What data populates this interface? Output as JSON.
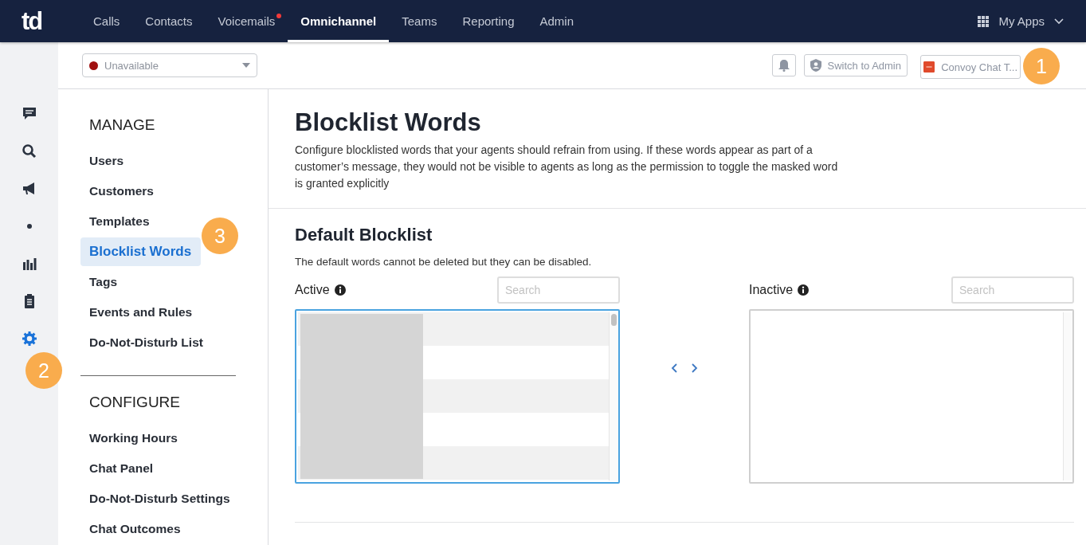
{
  "nav": {
    "logo": "td",
    "tabs": [
      {
        "label": "Calls",
        "selected": false,
        "notification": false
      },
      {
        "label": "Contacts",
        "selected": false,
        "notification": false
      },
      {
        "label": "Voicemails",
        "selected": false,
        "notification": true
      },
      {
        "label": "Omnichannel",
        "selected": true,
        "notification": false
      },
      {
        "label": "Teams",
        "selected": false,
        "notification": false
      },
      {
        "label": "Reporting",
        "selected": false,
        "notification": false
      },
      {
        "label": "Admin",
        "selected": false,
        "notification": false
      }
    ],
    "apps": "My Apps"
  },
  "rail": [
    {
      "kind": "chat",
      "selected": false
    },
    {
      "kind": "search",
      "selected": false
    },
    {
      "kind": "megaphone",
      "selected": false
    },
    {
      "kind": "dot",
      "selected": false
    },
    {
      "kind": "chart",
      "selected": false
    },
    {
      "kind": "clipboard",
      "selected": false
    },
    {
      "kind": "gear",
      "selected": true
    }
  ],
  "toolbar": {
    "status": {
      "value": "Unavailable",
      "color": "#a01010"
    },
    "switch_admin": "Switch to Admin",
    "workspace": "Convoy Chat T..."
  },
  "sidebar": [
    {
      "heading": "MANAGE",
      "items": [
        {
          "label": "Users",
          "selected": false
        },
        {
          "label": "Customers",
          "selected": false
        },
        {
          "label": "Templates",
          "selected": false
        },
        {
          "label": "Blocklist Words",
          "selected": true
        },
        {
          "label": "Tags",
          "selected": false
        },
        {
          "label": "Events and Rules",
          "selected": false
        },
        {
          "label": "Do-Not-Disturb List",
          "selected": false
        }
      ]
    },
    {
      "heading": "CONFIGURE",
      "items": [
        {
          "label": "Working Hours",
          "selected": false
        },
        {
          "label": "Chat Panel",
          "selected": false
        },
        {
          "label": "Do-Not-Disturb Settings",
          "selected": false
        },
        {
          "label": "Chat Outcomes",
          "selected": false
        }
      ]
    }
  ],
  "page": {
    "title": "Blocklist Words",
    "description": "Configure blocklisted words that your agents should refrain from using. If these words appear as part of a customer’s message, they would not be visible to agents as long as the permission to toggle the masked word is granted explicitly"
  },
  "section": {
    "title": "Default Blocklist",
    "note": "The default words cannot be deleted but they can be disabled.",
    "lists": [
      {
        "label": "Active",
        "search_placeholder": "Search",
        "focused": true,
        "filled": true
      },
      {
        "label": "Inactive",
        "search_placeholder": "Search",
        "focused": false,
        "filled": false
      }
    ]
  },
  "callouts": [
    "1",
    "2",
    "3"
  ]
}
